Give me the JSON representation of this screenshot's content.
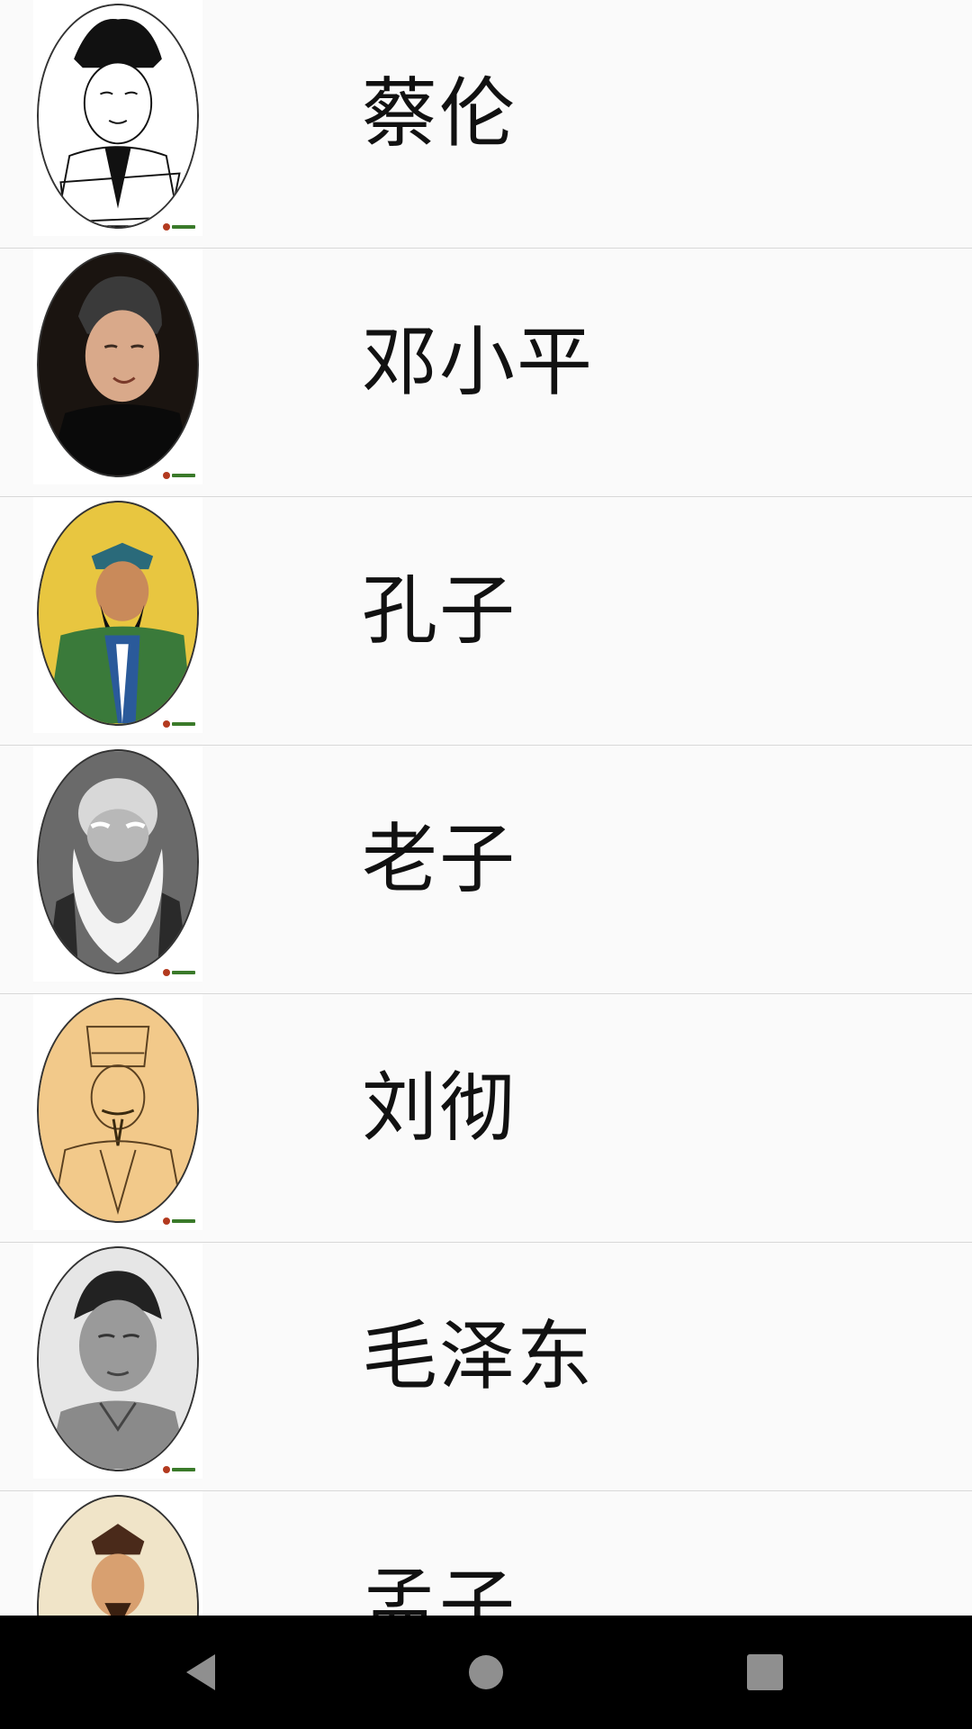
{
  "people": [
    {
      "name": "蔡伦",
      "portrait_icon": "cai-lun-portrait",
      "bg": "#ffffff"
    },
    {
      "name": "邓小平",
      "portrait_icon": "deng-xiaoping-portrait",
      "bg": "#1a1410"
    },
    {
      "name": "孔子",
      "portrait_icon": "confucius-portrait",
      "bg": "#e8c640"
    },
    {
      "name": "老子",
      "portrait_icon": "laozi-portrait",
      "bg": "#8a8a8a"
    },
    {
      "name": "刘彻",
      "portrait_icon": "liu-che-portrait",
      "bg": "#f2c98a"
    },
    {
      "name": "毛泽东",
      "portrait_icon": "mao-zedong-portrait",
      "bg": "#e6e6e6"
    },
    {
      "name": "孟子",
      "portrait_icon": "mencius-portrait",
      "bg": "#f0e4c8"
    }
  ],
  "navbar": {
    "back_icon": "back-triangle-icon",
    "home_icon": "home-circle-icon",
    "recents_icon": "recents-square-icon"
  }
}
